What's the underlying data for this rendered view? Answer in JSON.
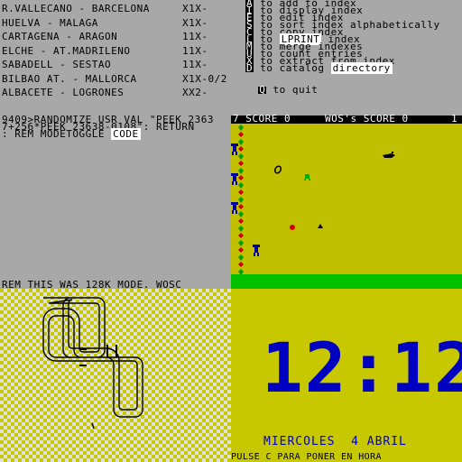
{
  "matches": [
    {
      "teams": "R.VALLECANO - BARCELONA",
      "result": "X1X-"
    },
    {
      "teams": "HUELVA - MALAGA",
      "result": "X1X-"
    },
    {
      "teams": "CARTAGENA - ARAGON",
      "result": "11X-"
    },
    {
      "teams": "ELCHE - AT.MADRILENO",
      "result": "11X-"
    },
    {
      "teams": "SABADELL - SESTAO",
      "result": "11X-"
    },
    {
      "teams": "BILBAO AT. - MALLORCA",
      "result": "X1X-0/2"
    },
    {
      "teams": "ALBACETE - LOGRONES",
      "result": "XX2-"
    }
  ],
  "menu": [
    {
      "key": "A",
      "text": " to add to index"
    },
    {
      "key": "I",
      "text": " to display index"
    },
    {
      "key": "E",
      "text": " to edit index"
    },
    {
      "key": "S",
      "text": " to sort index alphabetically"
    },
    {
      "key": "C",
      "text": " to copy index"
    },
    {
      "key": "L",
      "text": " to ",
      "extra": "LPRINT",
      "rest": " index"
    },
    {
      "key": "M",
      "text": " to merge indexes"
    },
    {
      "key": "U",
      "text": " to count entries"
    },
    {
      "key": "X",
      "text": " to extract from index"
    },
    {
      "key": "D",
      "text": " to catalog ",
      "extra": "directory",
      "rest": ""
    }
  ],
  "menu_quit": {
    "key": "Q",
    "text": " to quit"
  },
  "basic": {
    "line1": "9409>RANDOMIZE USR VAL \"PEEK 2363",
    "line2": "7+256*PEEK 23638-0108\": RETURN",
    "line3": ": REM MODETOGGLE ",
    "code_label": "CODE"
  },
  "rem_line": "REM THIS WAS 128K MODE. WOSC",
  "game": {
    "score_label": "7 SCORE 0",
    "hi_label": "WOS's SCORE 0",
    "corner": "1"
  },
  "clock": {
    "time": "12:12",
    "date": "MIERCOLES  4 ABRIL",
    "hint": "PULSE C PARA PONER EN HORA"
  },
  "colors": {
    "grey": "#a8a8a8",
    "yellow": "#c0c000",
    "blue": "#0000c0",
    "green": "#00c000"
  }
}
